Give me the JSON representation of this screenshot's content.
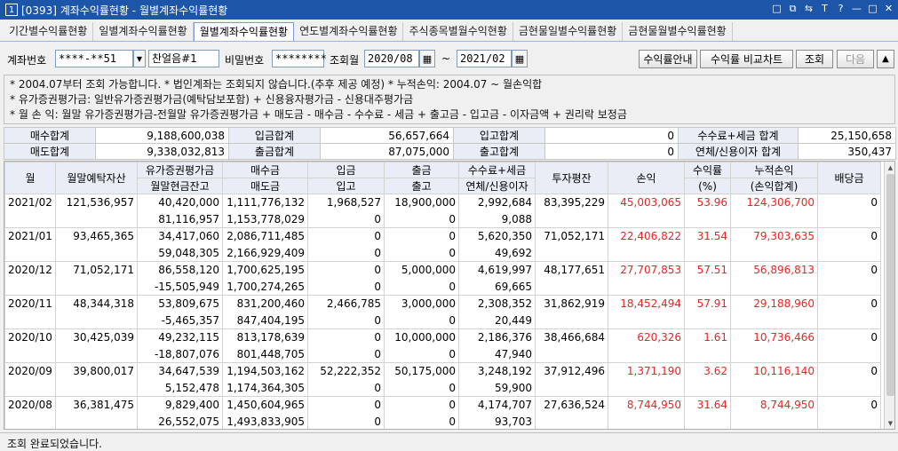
{
  "window": {
    "number": "1",
    "title": "[0393] 계좌수익률현황 - 월별계좌수익률현황",
    "controls": [
      "□",
      "⧉",
      "⇆",
      "T",
      "?",
      "—",
      "□",
      "✕"
    ]
  },
  "tabs": [
    {
      "label": "기간별수익률현황"
    },
    {
      "label": "일별계좌수익률현황"
    },
    {
      "label": "월별계좌수익률현황"
    },
    {
      "label": "연도별계좌수익률현황"
    },
    {
      "label": "주식종목별월수익현황"
    },
    {
      "label": "금현물일별수익률현황"
    },
    {
      "label": "금현물월별수익률현황"
    }
  ],
  "controls": {
    "account_label": "계좌번호",
    "account_value": "****-**51",
    "account_name": "찬얼음#1",
    "password_label": "비밀번호",
    "password_value": "********",
    "month_label": "조회월",
    "from_month": "2020/08",
    "tilde": "~",
    "to_month": "2021/02",
    "btn_guide": "수익률안내",
    "btn_compare": "수익률 비교차트",
    "btn_query": "조회",
    "btn_next": "다음",
    "btn_up": "▲"
  },
  "info_lines": [
    "* 2004.07부터 조회 가능합니다.   * 법인계좌는 조회되지 않습니다.(추후 제공 예정)   * 누적손익: 2004.07 ~ 월손익합",
    "* 유가증권평가금: 일반유가증권평가금(예탁담보포함) + 신용융자평가금 - 신용대주평가금",
    "* 월 손 익: 월말 유가증권평가금-전월말 유가증권평가금 + 매도금 - 매수금 - 수수료 - 세금 + 출고금 - 입고금 - 이자금액 + 권리락 보정금"
  ],
  "summary": {
    "row1": [
      {
        "label": "매수합계",
        "value": "9,188,600,038"
      },
      {
        "label": "입금합계",
        "value": "56,657,664"
      },
      {
        "label": "입고합계",
        "value": "0"
      },
      {
        "label": "수수료+세금 합계",
        "value": "25,150,658"
      }
    ],
    "row2": [
      {
        "label": "매도합계",
        "value": "9,338,032,813"
      },
      {
        "label": "출금합계",
        "value": "87,075,000"
      },
      {
        "label": "출고합계",
        "value": "0"
      },
      {
        "label": "연체/신용이자 합계",
        "value": "350,437"
      }
    ]
  },
  "grid": {
    "headers_top": [
      "월",
      "월말예탁자산",
      "유가증권평가금",
      "매수금",
      "입금",
      "출금",
      "수수료+세금",
      "투자평잔",
      "손익",
      "수익률",
      "누적손익",
      "배당금"
    ],
    "headers_bottom": [
      "월말현금잔고",
      "매도금",
      "입고",
      "출고",
      "연체/신용이자",
      "(%)",
      "(손익합계)"
    ],
    "rows": [
      {
        "month": "2021/02",
        "asset": "121,536,957",
        "eval": "40,420,000",
        "cash": "81,116,957",
        "buy": "1,111,776,132",
        "sell": "1,153,778,029",
        "deposit": "1,968,527",
        "in": "0",
        "withdraw": "18,900,000",
        "out": "0",
        "fee": "2,992,684",
        "interest": "9,088",
        "avg": "83,395,229",
        "pnl": "45,003,065",
        "rate": "53.96",
        "cum": "124,306,700",
        "div": "0"
      },
      {
        "month": "2021/01",
        "asset": "93,465,365",
        "eval": "34,417,060",
        "cash": "59,048,305",
        "buy": "2,086,711,485",
        "sell": "2,166,929,409",
        "deposit": "0",
        "in": "0",
        "withdraw": "0",
        "out": "0",
        "fee": "5,620,350",
        "interest": "49,692",
        "avg": "71,052,171",
        "pnl": "22,406,822",
        "rate": "31.54",
        "cum": "79,303,635",
        "div": "0"
      },
      {
        "month": "2020/12",
        "asset": "71,052,171",
        "eval": "86,558,120",
        "cash": "-15,505,949",
        "buy": "1,700,625,195",
        "sell": "1,700,274,265",
        "deposit": "0",
        "in": "0",
        "withdraw": "5,000,000",
        "out": "0",
        "fee": "4,619,997",
        "interest": "69,665",
        "avg": "48,177,651",
        "pnl": "27,707,853",
        "rate": "57.51",
        "cum": "56,896,813",
        "div": "0"
      },
      {
        "month": "2020/11",
        "asset": "48,344,318",
        "eval": "53,809,675",
        "cash": "-5,465,357",
        "buy": "831,200,460",
        "sell": "847,404,195",
        "deposit": "2,466,785",
        "in": "0",
        "withdraw": "3,000,000",
        "out": "0",
        "fee": "2,308,352",
        "interest": "20,449",
        "avg": "31,862,919",
        "pnl": "18,452,494",
        "rate": "57.91",
        "cum": "29,188,960",
        "div": "0"
      },
      {
        "month": "2020/10",
        "asset": "30,425,039",
        "eval": "49,232,115",
        "cash": "-18,807,076",
        "buy": "813,178,639",
        "sell": "801,448,705",
        "deposit": "0",
        "in": "0",
        "withdraw": "10,000,000",
        "out": "0",
        "fee": "2,186,376",
        "interest": "47,940",
        "avg": "38,466,684",
        "pnl": "620,326",
        "rate": "1.61",
        "cum": "10,736,466",
        "div": "0"
      },
      {
        "month": "2020/09",
        "asset": "39,800,017",
        "eval": "34,647,539",
        "cash": "5,152,478",
        "buy": "1,194,503,162",
        "sell": "1,174,364,305",
        "deposit": "52,222,352",
        "in": "0",
        "withdraw": "50,175,000",
        "out": "0",
        "fee": "3,248,192",
        "interest": "59,900",
        "avg": "37,912,496",
        "pnl": "1,371,190",
        "rate": "3.62",
        "cum": "10,116,140",
        "div": "0"
      },
      {
        "month": "2020/08",
        "asset": "36,381,475",
        "eval": "9,829,400",
        "cash": "26,552,075",
        "buy": "1,450,604,965",
        "sell": "1,493,833,905",
        "deposit": "0",
        "in": "0",
        "withdraw": "0",
        "out": "0",
        "fee": "4,174,707",
        "interest": "93,703",
        "avg": "27,636,524",
        "pnl": "8,744,950",
        "rate": "31.64",
        "cum": "8,744,950",
        "div": "0"
      }
    ]
  },
  "status": {
    "text": "조회 완료되었습니다."
  },
  "colors": {
    "title_bar": "#1d56a8",
    "profit": "#e22222",
    "header_bg": "#e9eef6"
  }
}
